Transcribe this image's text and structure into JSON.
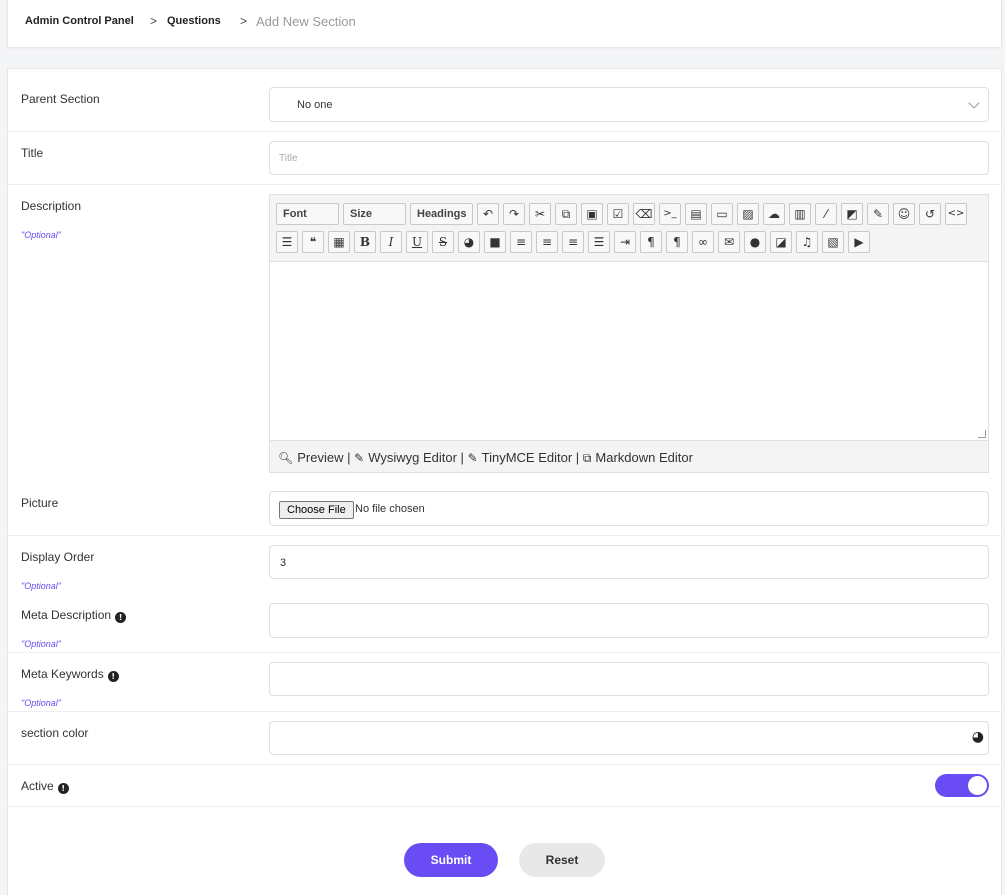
{
  "breadcrumb": {
    "items": [
      "Admin Control Panel",
      "Questions"
    ],
    "separator": ">",
    "current": "Add New Section"
  },
  "form": {
    "parent_section": {
      "label": "Parent Section",
      "value": "No one"
    },
    "title": {
      "label": "Title",
      "placeholder": "Title",
      "value": ""
    },
    "description": {
      "label": "Description",
      "optional": "\"Optional\"",
      "toolbar": {
        "dropdowns": [
          "Font",
          "Size",
          "Headings"
        ],
        "row1_icons": [
          "undo-icon",
          "redo-icon",
          "cut-icon",
          "copy-icon",
          "paste-icon",
          "select-all-icon",
          "eraser-icon",
          "code-icon",
          "template-icon",
          "frame-icon",
          "image-icon",
          "upload-icon",
          "archive-icon",
          "link-icon",
          "note-icon",
          "edit-icon",
          "smiley-icon",
          "history-icon",
          "source-code-icon"
        ],
        "row2_icons": [
          "list-icon",
          "quote-icon",
          "qrcode-icon",
          "bold-icon",
          "italic-icon",
          "underline-icon",
          "strikethrough-icon",
          "palette-icon",
          "color-square-icon",
          "align-right-icon",
          "align-center-icon",
          "align-left-icon",
          "justify-icon",
          "indent-icon",
          "ltr-icon",
          "rtl-icon",
          "chain-link-icon",
          "envelope-icon",
          "comment-icon",
          "external-icon",
          "music-icon",
          "movie-icon",
          "youtube-icon"
        ]
      },
      "footer": {
        "preview": "Preview",
        "wysiwyg": "Wysiwyg Editor",
        "tinymce": "TinyMCE Editor",
        "markdown": "Markdown Editor",
        "sep": "|"
      }
    },
    "picture": {
      "label": "Picture",
      "button": "Choose File",
      "status": "No file chosen"
    },
    "display_order": {
      "label": "Display Order",
      "optional": "\"Optional\"",
      "value": "3"
    },
    "meta_description": {
      "label": "Meta Description",
      "optional": "\"Optional\"",
      "value": ""
    },
    "meta_keywords": {
      "label": "Meta Keywords",
      "optional": "\"Optional\"",
      "value": ""
    },
    "section_color": {
      "label": "section color",
      "value": ""
    },
    "active": {
      "label": "Active",
      "on": true
    }
  },
  "actions": {
    "submit": "Submit",
    "reset": "Reset"
  },
  "colors": {
    "accent": "#6a4cf4"
  }
}
